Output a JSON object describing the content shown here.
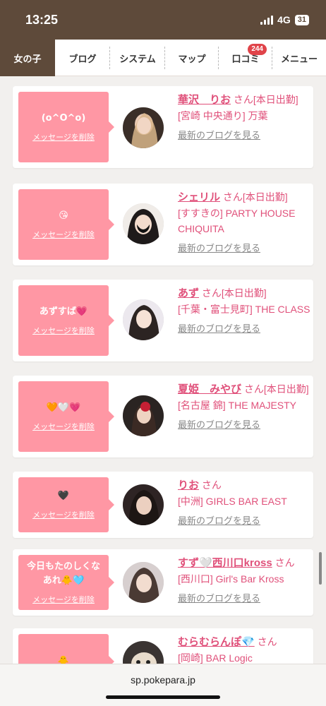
{
  "status": {
    "time": "13:25",
    "network": "4G",
    "battery": "31"
  },
  "nav": {
    "tabs": [
      {
        "label": "女の子",
        "active": true
      },
      {
        "label": "ブログ"
      },
      {
        "label": "システム"
      },
      {
        "label": "マップ"
      },
      {
        "label": "口コミ",
        "badge": "244"
      },
      {
        "label": "メニュー"
      }
    ]
  },
  "delete_label": "メッセージを削除",
  "blog_label": "最新のブログを見る",
  "cards": [
    {
      "message": "(o^O^o)",
      "name": "華沢　りお",
      "suffix": "さん[本日出勤]",
      "shop": "[宮崎 中央通り] 万葉"
    },
    {
      "message": "😘",
      "name": "シェリル",
      "suffix": "さん[本日出勤]",
      "shop": "[すすきの] PARTY HOUSE CHIQUITA"
    },
    {
      "message": "あずすば💗",
      "name": "あず",
      "suffix": "さん[本日出勤]",
      "shop": "[千葉・富士見町] THE CLASS"
    },
    {
      "message": "🧡🤍💗",
      "name": "夏姫　みやび",
      "suffix": "さん[本日出勤]",
      "shop": "[名古屋 錦] THE MAJESTY"
    },
    {
      "message": "🖤",
      "name": "りお",
      "suffix": "さん",
      "shop": "[中洲] GIRLS BAR EAST"
    },
    {
      "message": "今日もたのしくなあれ🐥🩵",
      "name": "すず🤍西川口kross",
      "suffix": "さん",
      "shop": "[西川口] Girl's Bar Kross"
    },
    {
      "message": "🐥",
      "name": "むらむらんぽ💎",
      "suffix": "さん",
      "shop": "[岡崎] BAR Logic"
    }
  ],
  "url": "sp.pokepara.jp",
  "colors": {
    "accent": "#ff97a4",
    "name": "#e0507a",
    "header": "#5e4a3a"
  }
}
